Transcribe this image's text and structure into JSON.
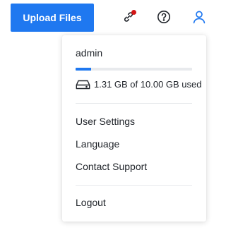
{
  "toolbar": {
    "upload_label": "Upload Files",
    "accent_color": "#1f78f0",
    "notification_dot_color": "#d21515",
    "icons": [
      "link-icon",
      "help-icon",
      "user-icon"
    ]
  },
  "account_menu": {
    "username": "admin",
    "storage": {
      "used_fraction": 0.131,
      "text": "1.31 GB of 10.00 GB used",
      "icon": "hard-drive-icon"
    },
    "items": [
      {
        "label": "User Settings"
      },
      {
        "label": "Language"
      },
      {
        "label": "Contact Support"
      }
    ],
    "logout_label": "Logout"
  }
}
